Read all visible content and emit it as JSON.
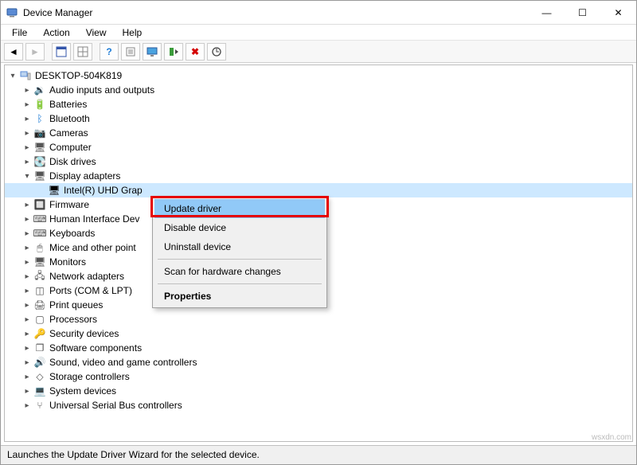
{
  "title": "Device Manager",
  "window_controls": {
    "min": "—",
    "max": "☐",
    "close": "✕"
  },
  "menubar": [
    "File",
    "Action",
    "View",
    "Help"
  ],
  "toolbar_icons": [
    "back",
    "forward",
    "show",
    "frame",
    "help",
    "props",
    "monitor",
    "scan",
    "remove",
    "update"
  ],
  "root": {
    "label": "DESKTOP-504K819"
  },
  "categories": [
    {
      "label": "Audio inputs and outputs",
      "icon": "🔉",
      "expandable": true
    },
    {
      "label": "Batteries",
      "icon": "🔋",
      "expandable": true
    },
    {
      "label": "Bluetooth",
      "icon": "ᛒ",
      "iconColor": "#1e7cd6",
      "expandable": true
    },
    {
      "label": "Cameras",
      "icon": "📷",
      "expandable": true
    },
    {
      "label": "Computer",
      "icon": "🖥",
      "expandable": true
    },
    {
      "label": "Disk drives",
      "icon": "💽",
      "expandable": true
    },
    {
      "label": "Display adapters",
      "icon": "🖥",
      "expandable": true,
      "expanded": true,
      "children": [
        {
          "label": "Intel(R) UHD Graphics",
          "icon": "🖥",
          "selected": true
        }
      ]
    },
    {
      "label": "Firmware",
      "icon": "🔲",
      "expandable": true
    },
    {
      "label": "Human Interface Devices",
      "icon": "⌨",
      "expandable": true,
      "clipped": "Human Interface Dev"
    },
    {
      "label": "Keyboards",
      "icon": "⌨",
      "expandable": true
    },
    {
      "label": "Mice and other pointing devices",
      "icon": "🖱",
      "expandable": true,
      "clipped": "Mice and other point"
    },
    {
      "label": "Monitors",
      "icon": "🖥",
      "expandable": true
    },
    {
      "label": "Network adapters",
      "icon": "🖧",
      "expandable": true
    },
    {
      "label": "Ports (COM & LPT)",
      "icon": "◫",
      "expandable": true
    },
    {
      "label": "Print queues",
      "icon": "🖨",
      "expandable": true
    },
    {
      "label": "Processors",
      "icon": "▢",
      "expandable": true
    },
    {
      "label": "Security devices",
      "icon": "🔑",
      "expandable": true
    },
    {
      "label": "Software components",
      "icon": "❐",
      "expandable": true
    },
    {
      "label": "Sound, video and game controllers",
      "icon": "🔊",
      "expandable": true
    },
    {
      "label": "Storage controllers",
      "icon": "◇",
      "expandable": true
    },
    {
      "label": "System devices",
      "icon": "💻",
      "expandable": true
    },
    {
      "label": "Universal Serial Bus controllers",
      "icon": "⑂",
      "expandable": true
    }
  ],
  "context_menu": {
    "items": [
      {
        "label": "Update driver",
        "selected": true
      },
      {
        "label": "Disable device"
      },
      {
        "label": "Uninstall device"
      }
    ],
    "after_sep": [
      {
        "label": "Scan for hardware changes"
      }
    ],
    "after_sep2": [
      {
        "label": "Properties",
        "bold": true
      }
    ]
  },
  "status": "Launches the Update Driver Wizard for the selected device.",
  "watermark": "wsxdn.com"
}
